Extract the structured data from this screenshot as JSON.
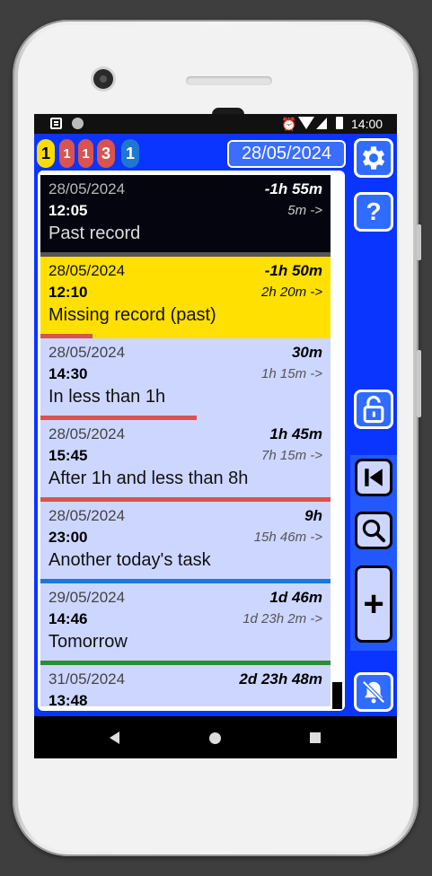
{
  "status_bar": {
    "time": "14:00"
  },
  "counters": [
    {
      "value": "1",
      "color": "#ffdd00"
    },
    {
      "value": "1",
      "color": "#d9534f"
    },
    {
      "value": "1",
      "color": "#d9534f"
    },
    {
      "value": "3",
      "color": "#d9534f"
    },
    {
      "value": "1",
      "color": "#1f77d4"
    }
  ],
  "header": {
    "date": "28/05/2024"
  },
  "records": [
    {
      "date": "28/05/2024",
      "delta": "-1h 55m",
      "time": "12:05",
      "duration": "5m ->",
      "title": "Past record",
      "kind": "past",
      "bar_color": "#555555",
      "bar_fraction": 1.0
    },
    {
      "date": "28/05/2024",
      "delta": "-1h 50m",
      "time": "12:10",
      "duration": "2h 20m ->",
      "title": "Missing record (past)",
      "kind": "missing",
      "bar_color": "#d9534f",
      "bar_fraction": 0.18
    },
    {
      "date": "28/05/2024",
      "delta": "30m",
      "time": "14:30",
      "duration": "1h 15m ->",
      "title": "In less than 1h",
      "kind": "normal",
      "bar_color": "#d9534f",
      "bar_fraction": 0.54
    },
    {
      "date": "28/05/2024",
      "delta": "1h 45m",
      "time": "15:45",
      "duration": "7h 15m ->",
      "title": "After 1h and less than 8h",
      "kind": "normal",
      "bar_color": "#d9534f",
      "bar_fraction": 1.0
    },
    {
      "date": "28/05/2024",
      "delta": "9h",
      "time": "23:00",
      "duration": "15h 46m ->",
      "title": "Another today's task",
      "kind": "normal",
      "bar_color": "#1f77d4",
      "bar_fraction": 1.0
    },
    {
      "date": "29/05/2024",
      "delta": "1d 46m",
      "time": "14:46",
      "duration": "1d 23h 2m ->",
      "title": "Tomorrow",
      "kind": "normal",
      "bar_color": "#2e8b3a",
      "bar_fraction": 1.0
    },
    {
      "date": "31/05/2024",
      "delta": "2d 23h 48m",
      "time": "13:48",
      "duration": "",
      "title": "",
      "kind": "normal",
      "bar_color": "",
      "bar_fraction": 0
    }
  ]
}
